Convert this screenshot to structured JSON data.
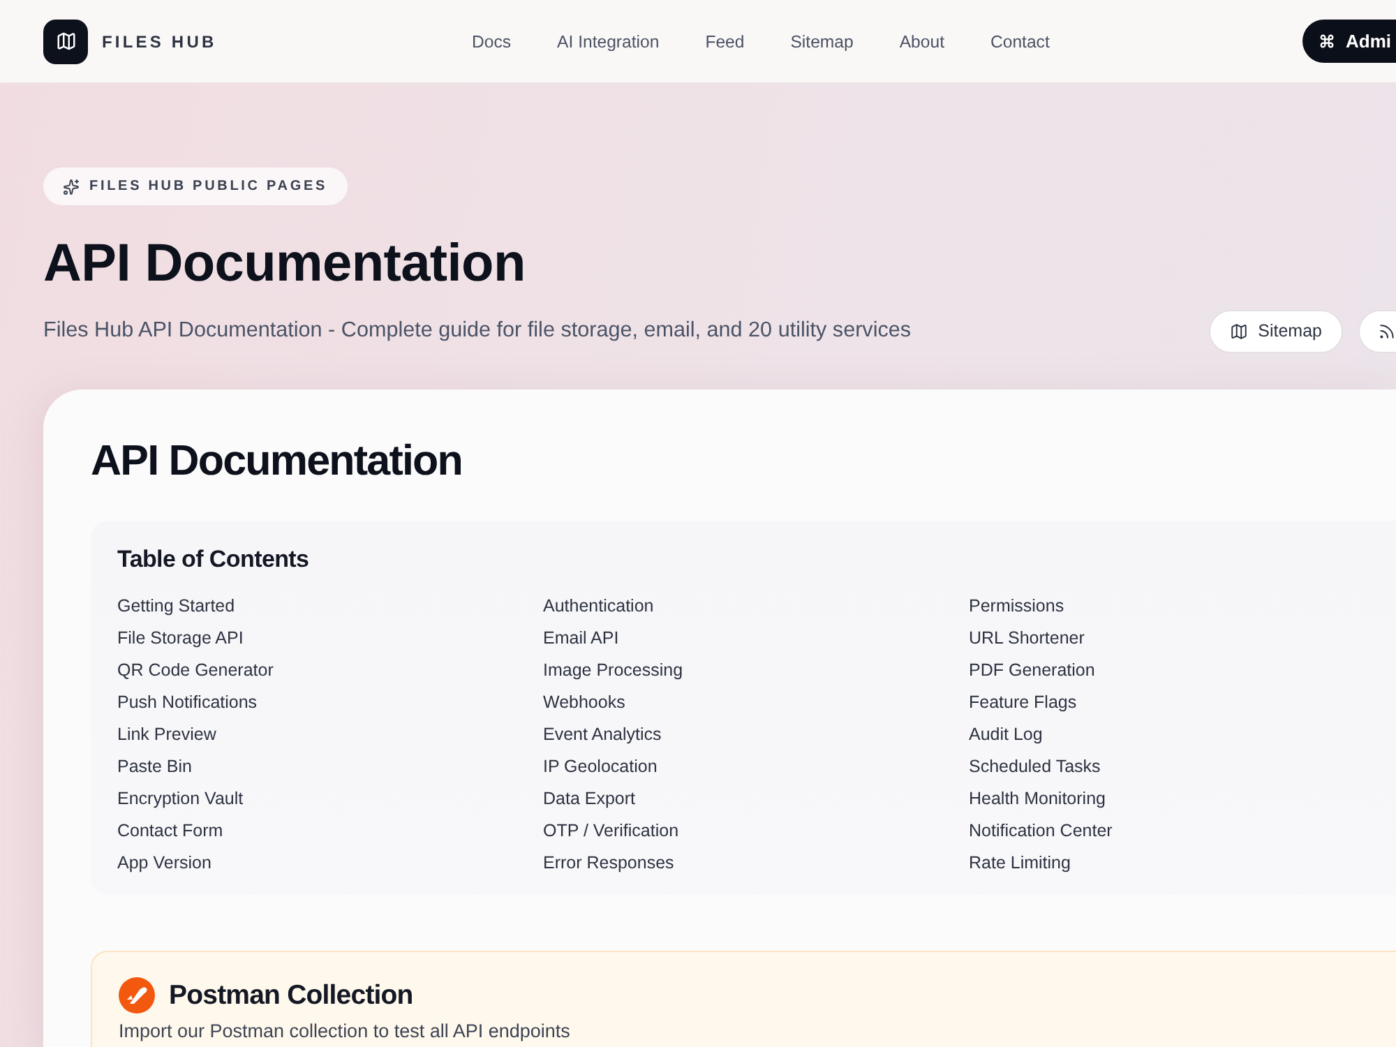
{
  "header": {
    "brand": "FILES HUB",
    "nav": [
      {
        "label": "Docs"
      },
      {
        "label": "AI Integration"
      },
      {
        "label": "Feed"
      },
      {
        "label": "Sitemap"
      },
      {
        "label": "About"
      },
      {
        "label": "Contact"
      }
    ],
    "admin_button": "Admi"
  },
  "hero": {
    "badge": "FILES HUB PUBLIC PAGES",
    "title": "API Documentation",
    "subtitle": "Files Hub API Documentation - Complete guide for file storage, email, and 20 utility services",
    "buttons": [
      {
        "kind": "sitemap",
        "label": "Sitemap"
      },
      {
        "kind": "rss"
      }
    ]
  },
  "card": {
    "title": "API Documentation",
    "toc": {
      "title": "Table of Contents",
      "items": [
        "Getting Started",
        "Authentication",
        "Permissions",
        "File Storage API",
        "Email API",
        "URL Shortener",
        "QR Code Generator",
        "Image Processing",
        "PDF Generation",
        "Push Notifications",
        "Webhooks",
        "Feature Flags",
        "Link Preview",
        "Event Analytics",
        "Audit Log",
        "Paste Bin",
        "IP Geolocation",
        "Scheduled Tasks",
        "Encryption Vault",
        "Data Export",
        "Health Monitoring",
        "Contact Form",
        "OTP / Verification",
        "Notification Center",
        "App Version",
        "Error Responses",
        "Rate Limiting"
      ]
    },
    "postman": {
      "title": "Postman Collection",
      "text": "Import our Postman collection to test all API endpoints"
    }
  }
}
